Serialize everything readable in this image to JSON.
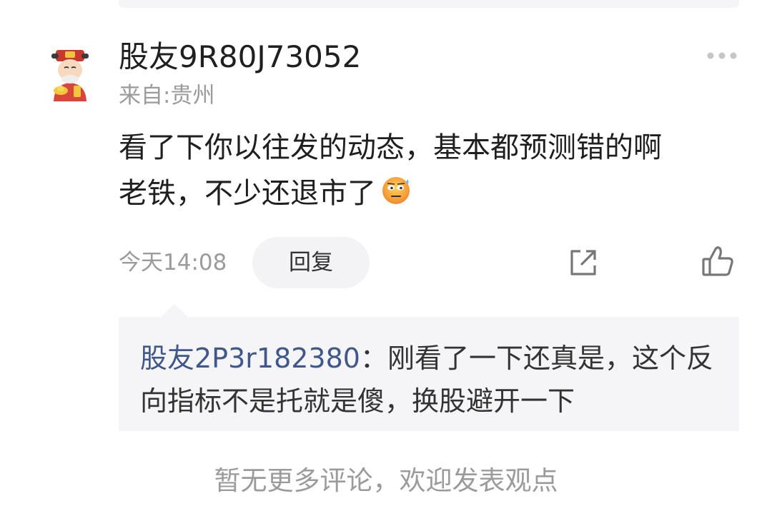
{
  "comment": {
    "username": "股友9R80J73052",
    "location": "来自:贵州",
    "text_line1": "看了下你以往发的动态，基本都预测错的啊",
    "text_line2": "老铁，不少还退市了",
    "emoji": "sweat-smile-emoji",
    "timestamp": "今天14:08",
    "reply_label": "回复",
    "icons": {
      "more": "more-dots-icon",
      "share": "share-icon",
      "like": "thumbs-up-icon"
    }
  },
  "reply": {
    "username": "股友2P3r182380",
    "separator": "：",
    "text_line1": "刚看了一下还真是，这个反",
    "text_line2": "向指标不是托就是傻，换股避开一下"
  },
  "footer": {
    "note": "暂无更多评论，欢迎发表观点"
  },
  "colors": {
    "reply_username": "#40578a",
    "muted_text": "#9b9b9b",
    "panel_bg": "#f5f5f7"
  }
}
